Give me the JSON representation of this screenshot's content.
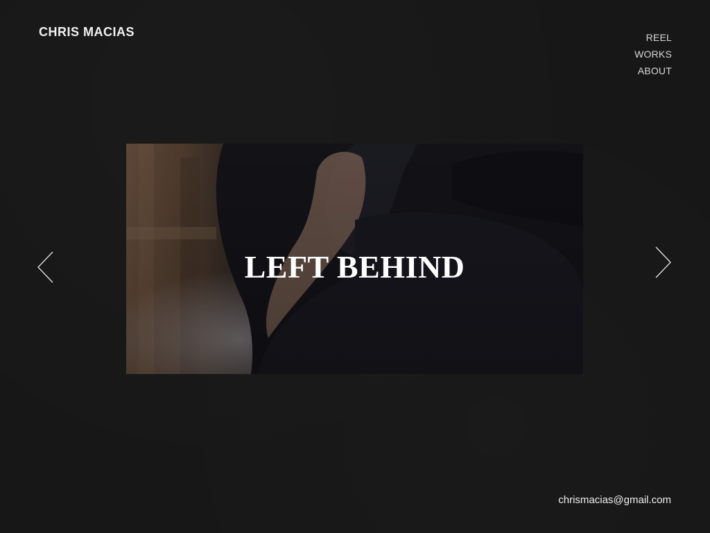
{
  "header": {
    "site_title": "CHRIS MACIAS"
  },
  "nav": {
    "items": [
      {
        "label": "REEL"
      },
      {
        "label": "WORKS"
      },
      {
        "label": "ABOUT"
      }
    ]
  },
  "slider": {
    "slide_title": "LEFT BEHIND",
    "prev_icon": "chevron-left-icon",
    "next_icon": "chevron-right-icon"
  },
  "footer": {
    "email": "chrismacias@gmail.com"
  },
  "colors": {
    "background": "#171717",
    "text": "#f2f2f2",
    "nav_text": "#d8d8d8"
  }
}
